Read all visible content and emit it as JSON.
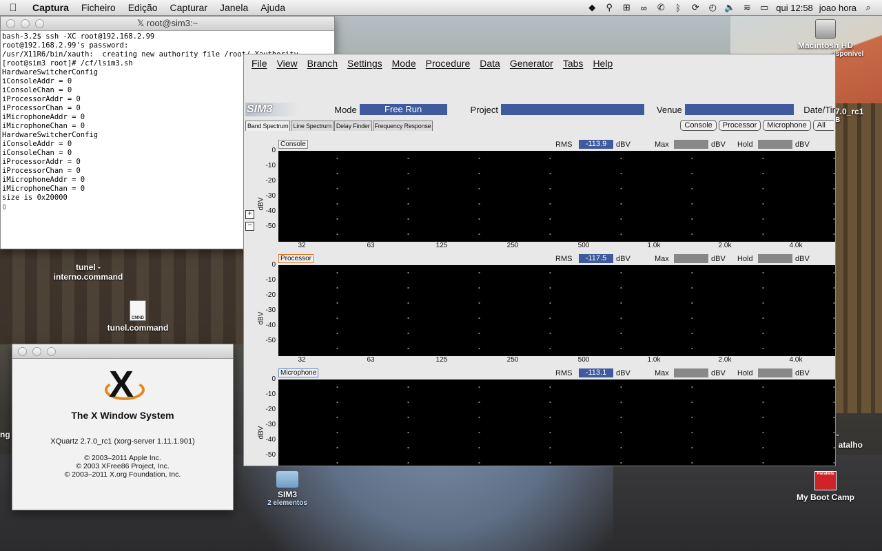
{
  "menubar": {
    "app": "Captura",
    "items": [
      "Ficheiro",
      "Edição",
      "Capturar",
      "Janela",
      "Ajuda"
    ],
    "clock": "qui 12:58",
    "user": "joao  hora"
  },
  "desktop": {
    "icons": {
      "hd": "Macintosh HD",
      "tunel_interno": "tunel -\ninterno.command",
      "tunel": "tunel.command",
      "cmd_badge": "CMND",
      "sim3": "SIM3",
      "sim3_sub": "2 elementos",
      "bootcamp": "My Boot Camp",
      "bootcamp_badge": "Parallels"
    },
    "fragments": {
      "hd_sub": "isponível",
      "xquartz_right": "7.0_rc1",
      "right_b": "B",
      "shortcut_a": "o-",
      "shortcut_b": "d atalho",
      "left_ng": "ng"
    }
  },
  "xterm": {
    "title": "root@sim3:~",
    "lines": [
      "bash-3.2$ ssh -XC root@192.168.2.99",
      "root@192.168.2.99's password:",
      "/usr/X11R6/bin/xauth:  creating new authority file /root/.Xauthority",
      "[root@sim3 root]# /cf/lsim3.sh",
      "HardwareSwitcherConfig",
      "iConsoleAddr = 0",
      "iConsoleChan = 0",
      "iProcessorAddr = 0",
      "iProcessorChan = 0",
      "iMicrophoneAddr = 0",
      "iMicrophoneChan = 0",
      "HardwareSwitcherConfig",
      "iConsoleAddr = 0",
      "iConsoleChan = 0",
      "iProcessorAddr = 0",
      "iProcessorChan = 0",
      "iMicrophoneAddr = 0",
      "iMicrophoneChan = 0",
      "size is 0x20000",
      "▯"
    ]
  },
  "about": {
    "heading": "The X Window System",
    "version": "XQuartz 2.7.0_rc1 (xorg-server 1.11.1.901)",
    "copyright": [
      "© 2003–2011 Apple Inc.",
      "© 2003 XFree86 Project, Inc.",
      "© 2003–2011 X.org Foundation, Inc."
    ]
  },
  "sim3": {
    "menu": [
      "File",
      "View",
      "Branch",
      "Settings",
      "Mode",
      "Procedure",
      "Data",
      "Generator",
      "Tabs",
      "Help"
    ],
    "logo": "SIM3",
    "mode_label": "Mode",
    "mode_value": "Free Run",
    "project_label": "Project",
    "project_value": "",
    "venue_label": "Venue",
    "venue_value": "",
    "date_label": "Date/Tir",
    "tabs": [
      "Band Spectrum",
      "Line Spectrum",
      "Delay Finder",
      "Frequency Response"
    ],
    "channel_buttons": [
      "Console",
      "Processor",
      "Microphone",
      "All"
    ],
    "rms_label": "RMS",
    "max_label": "Max",
    "hold_label": "Hold",
    "unit": "dBV",
    "y_title": "dBV",
    "y_ticks": [
      "0",
      "-10",
      "-20",
      "-30",
      "-40",
      "-50"
    ],
    "x_ticks": [
      "32",
      "63",
      "125",
      "250",
      "500",
      "1.0k",
      "2.0k",
      "4.0k"
    ],
    "zoom_in": "+",
    "zoom_out": "−",
    "panels": [
      {
        "name": "Console",
        "rms": "-113.9"
      },
      {
        "name": "Processor",
        "rms": "-117.5"
      },
      {
        "name": "Microphone",
        "rms": "-113.1"
      }
    ]
  }
}
